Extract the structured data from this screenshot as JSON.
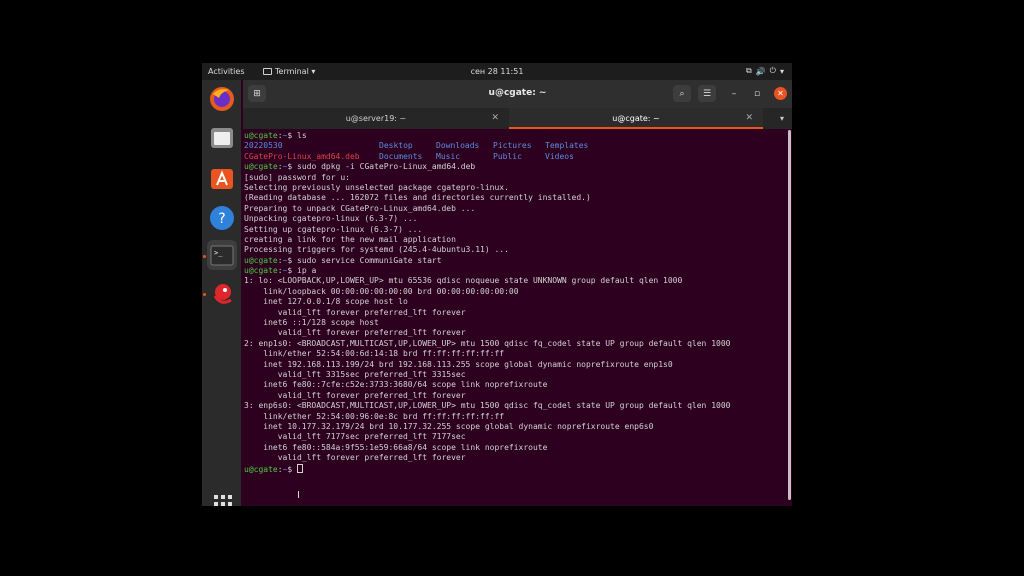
{
  "topbar": {
    "activities": "Activities",
    "app_menu": "Terminal ▾",
    "clock": "сен 28  11:51",
    "tray": [
      "⧉",
      "🔊",
      "⏻",
      "▾"
    ]
  },
  "dock": {
    "items": [
      "firefox-icon",
      "files-icon",
      "software-icon",
      "help-icon",
      "terminal-icon",
      "communigate-icon"
    ],
    "grid_icon": "show-apps-icon"
  },
  "window": {
    "title": "u@cgate: ~",
    "new_tab": "⊞",
    "search": "⌕",
    "menu": "☰",
    "minimize": "–",
    "maximize": "▫",
    "close": "✕"
  },
  "tabs": [
    {
      "label": "u@server19: ~",
      "close": "✕"
    },
    {
      "label": "u@cgate: ~",
      "close": "✕"
    }
  ],
  "tab_menu": "▾",
  "terminal": {
    "prompt_user": "u@cgate",
    "prompt_sep": ":",
    "prompt_path": "~",
    "prompt_end": "$",
    "lines": [
      {
        "type": "prompt",
        "cmd": " ls"
      },
      {
        "type": "ls1",
        "cols": [
          "20220530",
          "Desktop",
          "Downloads",
          "Pictures",
          "Templates"
        ]
      },
      {
        "type": "ls2",
        "cols": [
          "CGatePro-Linux_amd64.deb",
          "Documents",
          "Music",
          "Public",
          "Videos"
        ]
      },
      {
        "type": "prompt",
        "cmd": " sudo dpkg -i CGatePro-Linux_amd64.deb"
      },
      {
        "type": "out",
        "text": "[sudo] password for u:"
      },
      {
        "type": "out",
        "text": "Selecting previously unselected package cgatepro-linux."
      },
      {
        "type": "out",
        "text": "(Reading database ... 162072 files and directories currently installed.)"
      },
      {
        "type": "out",
        "text": "Preparing to unpack CGatePro-Linux_amd64.deb ..."
      },
      {
        "type": "out",
        "text": "Unpacking cgatepro-linux (6.3-7) ..."
      },
      {
        "type": "out",
        "text": "Setting up cgatepro-linux (6.3-7) ..."
      },
      {
        "type": "out",
        "text": "creating a link for the new mail application"
      },
      {
        "type": "out",
        "text": "Processing triggers for systemd (245.4-4ubuntu3.11) ..."
      },
      {
        "type": "prompt",
        "cmd": " sudo service CommuniGate start"
      },
      {
        "type": "prompt",
        "cmd": " ip a"
      },
      {
        "type": "out",
        "text": "1: lo: <LOOPBACK,UP,LOWER_UP> mtu 65536 qdisc noqueue state UNKNOWN group default qlen 1000"
      },
      {
        "type": "out",
        "text": "    link/loopback 00:00:00:00:00:00 brd 00:00:00:00:00:00"
      },
      {
        "type": "out",
        "text": "    inet 127.0.0.1/8 scope host lo"
      },
      {
        "type": "out",
        "text": "       valid_lft forever preferred_lft forever"
      },
      {
        "type": "out",
        "text": "    inet6 ::1/128 scope host"
      },
      {
        "type": "out",
        "text": "       valid_lft forever preferred_lft forever"
      },
      {
        "type": "out",
        "text": "2: enp1s0: <BROADCAST,MULTICAST,UP,LOWER_UP> mtu 1500 qdisc fq_codel state UP group default qlen 1000"
      },
      {
        "type": "out",
        "text": "    link/ether 52:54:00:6d:14:18 brd ff:ff:ff:ff:ff:ff"
      },
      {
        "type": "out",
        "text": "    inet 192.168.113.199/24 brd 192.168.113.255 scope global dynamic noprefixroute enp1s0"
      },
      {
        "type": "out",
        "text": "       valid_lft 3315sec preferred_lft 3315sec"
      },
      {
        "type": "out",
        "text": "    inet6 fe80::7cfe:c52e:3733:3680/64 scope link noprefixroute"
      },
      {
        "type": "out",
        "text": "       valid_lft forever preferred_lft forever"
      },
      {
        "type": "out",
        "text": "3: enp6s0: <BROADCAST,MULTICAST,UP,LOWER_UP> mtu 1500 qdisc fq_codel state UP group default qlen 1000"
      },
      {
        "type": "out",
        "text": "    link/ether 52:54:00:96:0e:8c brd ff:ff:ff:ff:ff:ff"
      },
      {
        "type": "out",
        "text": "    inet 10.177.32.179/24 brd 10.177.32.255 scope global dynamic noprefixroute enp6s0"
      },
      {
        "type": "out",
        "text": "       valid_lft 7177sec preferred_lft 7177sec"
      },
      {
        "type": "out",
        "text": "    inet6 fe80::584a:9f55:1e59:66a8/64 scope link noprefixroute"
      },
      {
        "type": "out",
        "text": "       valid_lft forever preferred_lft forever"
      },
      {
        "type": "prompt",
        "cmd": " "
      }
    ]
  },
  "colors": {
    "accent": "#e95420",
    "terminal_bg": "#2c001e",
    "prompt": "#4ec946",
    "path": "#5b8fd8",
    "dir": "#5f8be0",
    "deb": "#e0414b"
  }
}
